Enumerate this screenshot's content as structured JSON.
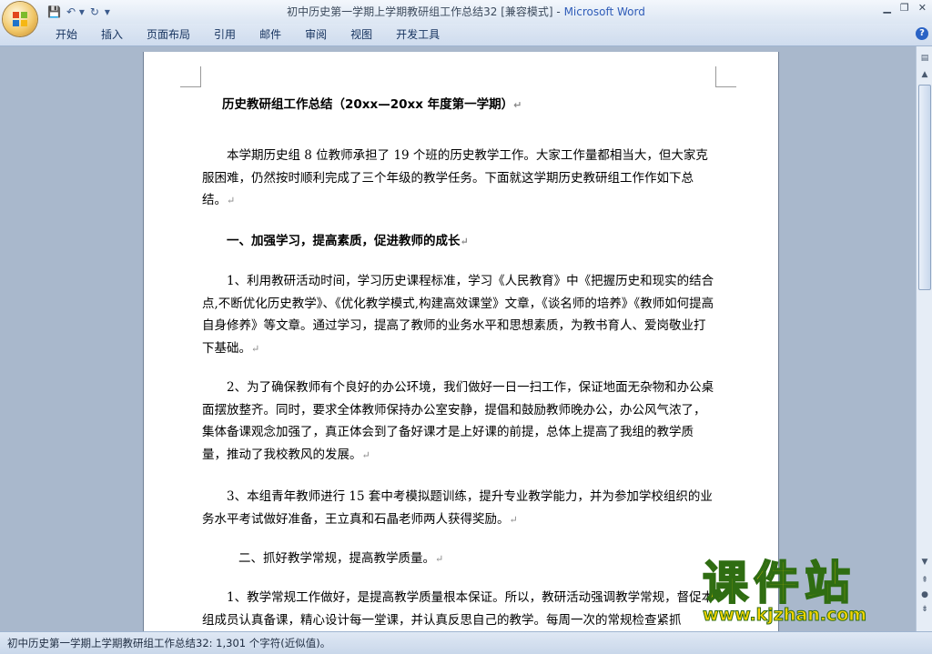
{
  "window": {
    "title": "初中历史第一学期上学期教研组工作总结32 [兼容模式] - ",
    "app_name": "Microsoft Word",
    "controls": [
      "▁",
      "❐",
      "✕"
    ]
  },
  "quick_access": {
    "save": "💾",
    "undo": "↶ ▾",
    "redo": "↻",
    "customize": "▾"
  },
  "ribbon": {
    "tabs": [
      "开始",
      "插入",
      "页面布局",
      "引用",
      "邮件",
      "审阅",
      "视图",
      "开发工具"
    ],
    "help": "?"
  },
  "document": {
    "heading": "历史教研组工作总结（20xx—20xx 年度第一学期）",
    "paragraphs": [
      "本学期历史组 8 位教师承担了 19 个班的历史教学工作。大家工作量都相当大，但大家克服困难，仍然按时顺利完成了三个年级的教学任务。下面就这学期历史教研组工作作如下总结。",
      "一、加强学习，提高素质，促进教师的成长",
      "1、利用教研活动时间，学习历史课程标准，学习《人民教育》中《把握历史和现实的结合点,不断优化历史教学》、《优化教学模式,构建高效课堂》文章，《谈名师的培养》《教师如何提高自身修养》等文章。通过学习，提高了教师的业务水平和思想素质，为教书育人、爱岗敬业打下基础。",
      "2、为了确保教师有个良好的办公环境，我们做好一日一扫工作，保证地面无杂物和办公桌面摆放整齐。同时，要求全体教师保持办公室安静，提倡和鼓励教师晚办公，办公风气浓了，集体备课观念加强了，真正体会到了备好课才是上好课的前提，总体上提高了我组的教学质量，推动了我校教风的发展。",
      "3、本组青年教师进行 15 套中考模拟题训练，提升专业教学能力，并为参加学校组织的业务水平考试做好准备，王立真和石晶老师两人获得奖励。",
      "二、抓好教学常规，提高教学质量。",
      "1、教学常规工作做好，是提高教学质量根本保证。所以，教研活动强调教学常规，督促本组成员认真备课，精心设计每一堂课，并认真反思自己的教学。每周一次的常规检查紧抓"
    ],
    "para_mark": "↵"
  },
  "status": {
    "text": "初中历史第一学期上学期教研组工作总结32: 1,301 个字符(近似值)。"
  },
  "watermark": {
    "big": "课件站",
    "url": "www.kjzhan.com"
  },
  "colors": {
    "accent": "#2f5cb8",
    "background": "#a9b8cc",
    "watermark_fill": "#f3d000",
    "watermark_stroke": "#2f6d12"
  }
}
